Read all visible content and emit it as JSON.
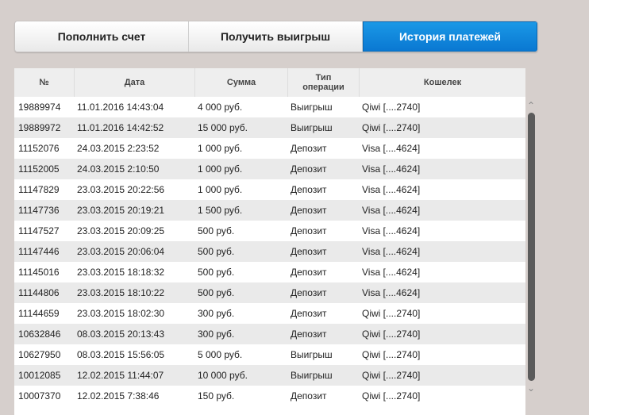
{
  "tabs": [
    {
      "label": "Пополнить счет",
      "active": false
    },
    {
      "label": "Получить выигрыш",
      "active": false
    },
    {
      "label": "История платежей",
      "active": true
    }
  ],
  "table": {
    "headers": [
      "№",
      "Дата",
      "Сумма",
      "Тип операции",
      "Кошелек"
    ],
    "rows": [
      [
        "19889974",
        "11.01.2016 14:43:04",
        "4 000 руб.",
        "Выигрыш",
        "Qiwi [....2740]"
      ],
      [
        "19889972",
        "11.01.2016 14:42:52",
        "15 000 руб.",
        "Выигрыш",
        "Qiwi [....2740]"
      ],
      [
        "11152076",
        "24.03.2015 2:23:52",
        "1 000 руб.",
        "Депозит",
        "Visa [....4624]"
      ],
      [
        "11152005",
        "24.03.2015 2:10:50",
        "1 000 руб.",
        "Депозит",
        "Visa [....4624]"
      ],
      [
        "11147829",
        "23.03.2015 20:22:56",
        "1 000 руб.",
        "Депозит",
        "Visa [....4624]"
      ],
      [
        "11147736",
        "23.03.2015 20:19:21",
        "1 500 руб.",
        "Депозит",
        "Visa [....4624]"
      ],
      [
        "11147527",
        "23.03.2015 20:09:25",
        "500 руб.",
        "Депозит",
        "Visa [....4624]"
      ],
      [
        "11147446",
        "23.03.2015 20:06:04",
        "500 руб.",
        "Депозит",
        "Visa [....4624]"
      ],
      [
        "11145016",
        "23.03.2015 18:18:32",
        "500 руб.",
        "Депозит",
        "Visa [....4624]"
      ],
      [
        "11144806",
        "23.03.2015 18:10:22",
        "500 руб.",
        "Депозит",
        "Visa [....4624]"
      ],
      [
        "11144659",
        "23.03.2015 18:02:30",
        "300 руб.",
        "Депозит",
        "Qiwi [....2740]"
      ],
      [
        "10632846",
        "08.03.2015 20:13:43",
        "300 руб.",
        "Депозит",
        "Qiwi [....2740]"
      ],
      [
        "10627950",
        "08.03.2015 15:56:05",
        "5 000 руб.",
        "Выигрыш",
        "Qiwi [....2740]"
      ],
      [
        "10012085",
        "12.02.2015 11:44:07",
        "10 000 руб.",
        "Выигрыш",
        "Qiwi [....2740]"
      ],
      [
        "10007370",
        "12.02.2015 7:38:46",
        "150 руб.",
        "Депозит",
        "Qiwi [....2740]"
      ]
    ]
  },
  "scrollbar": {
    "up_icon": "chevron-up-icon",
    "down_icon": "chevron-down-icon"
  },
  "colors": {
    "panel_bg": "#d6cfcc",
    "active_tab": "#0a78d2",
    "row_alt": "#eaeaea",
    "scroll_thumb": "#5b5b5b"
  }
}
